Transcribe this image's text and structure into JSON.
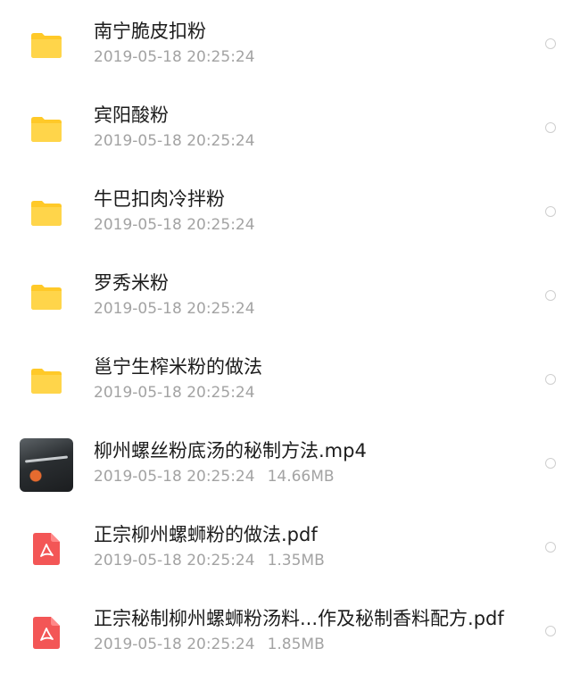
{
  "files": [
    {
      "name": "南宁脆皮扣粉",
      "date": "2019-05-18 20:25:24",
      "size": "",
      "icon": "folder-icon",
      "color": "#ffc928"
    },
    {
      "name": "宾阳酸粉",
      "date": "2019-05-18 20:25:24",
      "size": "",
      "icon": "folder-icon",
      "color": "#ffc928"
    },
    {
      "name": "牛巴扣肉冷拌粉",
      "date": "2019-05-18 20:25:24",
      "size": "",
      "icon": "folder-icon",
      "color": "#ffc928"
    },
    {
      "name": "罗秀米粉",
      "date": "2019-05-18 20:25:24",
      "size": "",
      "icon": "folder-icon",
      "color": "#ffc928"
    },
    {
      "name": "邕宁生榨米粉的做法",
      "date": "2019-05-18 20:25:24",
      "size": "",
      "icon": "folder-icon",
      "color": "#ffc928"
    },
    {
      "name": "柳州螺丝粉底汤的秘制方法.mp4",
      "date": "2019-05-18 20:25:24",
      "size": "14.66MB",
      "icon": "video-thumbnail",
      "color": "#2a2e31"
    },
    {
      "name": "正宗柳州螺蛳粉的做法.pdf",
      "date": "2019-05-18 20:25:24",
      "size": "1.35MB",
      "icon": "pdf-icon",
      "color": "#f35656"
    },
    {
      "name": "正宗秘制柳州螺蛳粉汤料...作及秘制香料配方.pdf",
      "date": "2019-05-18 20:25:24",
      "size": "1.85MB",
      "icon": "pdf-icon",
      "color": "#f35656"
    }
  ]
}
